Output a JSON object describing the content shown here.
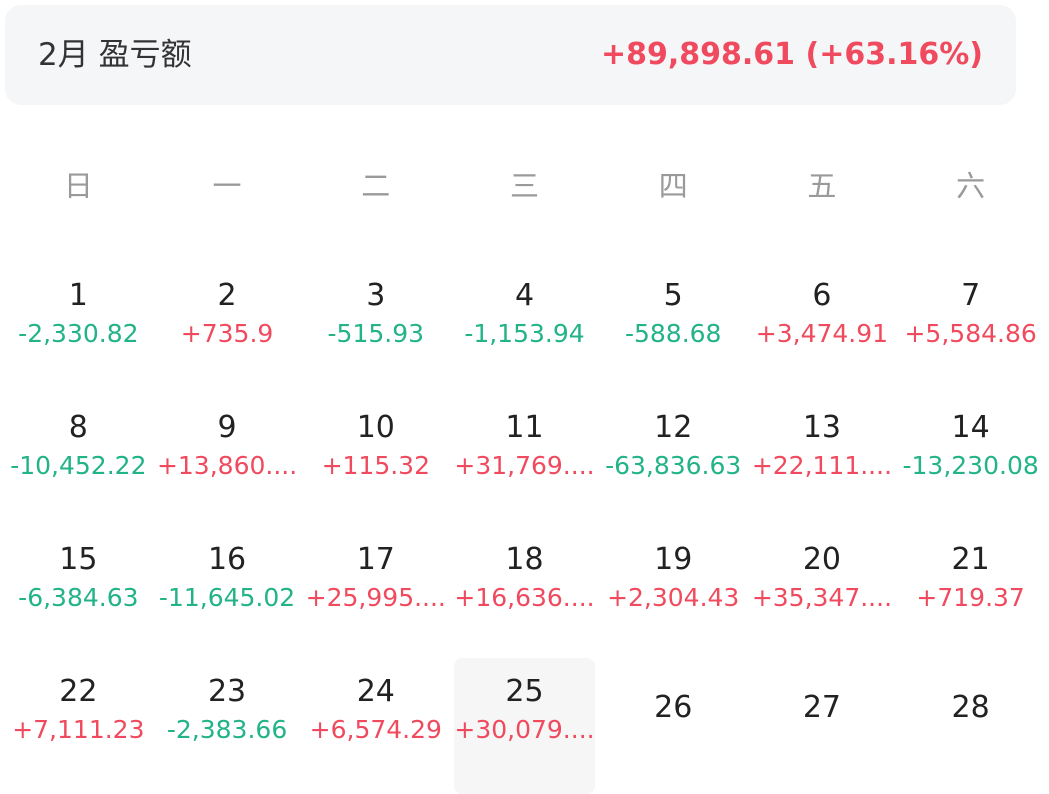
{
  "summary": {
    "title": "2月 盈亏额",
    "value": "+89,898.61 (+63.16%)",
    "value_color": "#f04a5e"
  },
  "colors": {
    "positive": "#f04a5e",
    "negative": "#23b388"
  },
  "weekdays": [
    "日",
    "一",
    "二",
    "三",
    "四",
    "五",
    "六"
  ],
  "days": [
    {
      "day": "1",
      "value": "-2,330.82",
      "sign": "neg"
    },
    {
      "day": "2",
      "value": "+735.9",
      "sign": "pos"
    },
    {
      "day": "3",
      "value": "-515.93",
      "sign": "neg"
    },
    {
      "day": "4",
      "value": "-1,153.94",
      "sign": "neg"
    },
    {
      "day": "5",
      "value": "-588.68",
      "sign": "neg"
    },
    {
      "day": "6",
      "value": "+3,474.91",
      "sign": "pos"
    },
    {
      "day": "7",
      "value": "+5,584.86",
      "sign": "pos"
    },
    {
      "day": "8",
      "value": "-10,452.22",
      "sign": "neg"
    },
    {
      "day": "9",
      "value": "+13,860....",
      "sign": "pos"
    },
    {
      "day": "10",
      "value": "+115.32",
      "sign": "pos"
    },
    {
      "day": "11",
      "value": "+31,769....",
      "sign": "pos"
    },
    {
      "day": "12",
      "value": "-63,836.63",
      "sign": "neg"
    },
    {
      "day": "13",
      "value": "+22,111....",
      "sign": "pos"
    },
    {
      "day": "14",
      "value": "-13,230.08",
      "sign": "neg"
    },
    {
      "day": "15",
      "value": "-6,384.63",
      "sign": "neg"
    },
    {
      "day": "16",
      "value": "-11,645.02",
      "sign": "neg"
    },
    {
      "day": "17",
      "value": "+25,995....",
      "sign": "pos"
    },
    {
      "day": "18",
      "value": "+16,636....",
      "sign": "pos"
    },
    {
      "day": "19",
      "value": "+2,304.43",
      "sign": "pos"
    },
    {
      "day": "20",
      "value": "+35,347....",
      "sign": "pos"
    },
    {
      "day": "21",
      "value": "+719.37",
      "sign": "pos"
    },
    {
      "day": "22",
      "value": "+7,111.23",
      "sign": "pos"
    },
    {
      "day": "23",
      "value": "-2,383.66",
      "sign": "neg"
    },
    {
      "day": "24",
      "value": "+6,574.29",
      "sign": "pos"
    },
    {
      "day": "25",
      "value": "+30,079....",
      "sign": "pos",
      "today": true
    },
    {
      "day": "26",
      "value": ""
    },
    {
      "day": "27",
      "value": ""
    },
    {
      "day": "28",
      "value": ""
    }
  ]
}
